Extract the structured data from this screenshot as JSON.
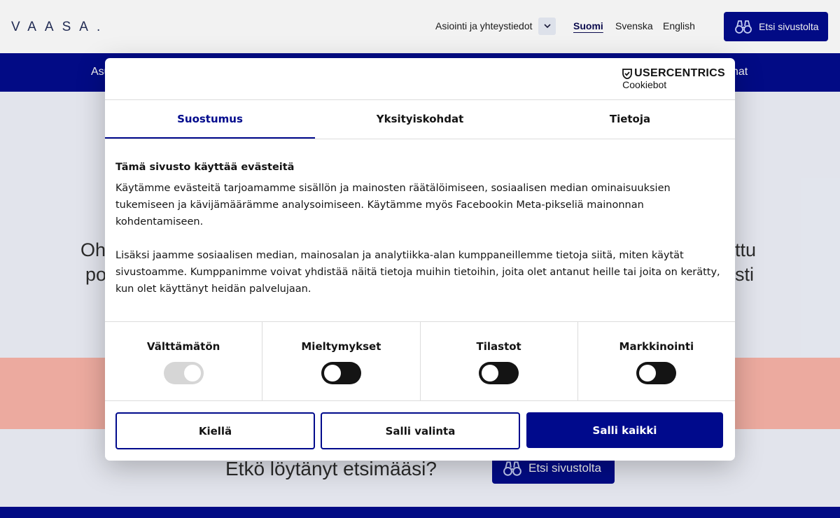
{
  "header": {
    "logo": "VAASA.",
    "service_link": "Asiointi ja yhteystiedot",
    "languages": [
      {
        "label": "Suomi",
        "active": true
      },
      {
        "label": "Svenska",
        "active": false
      },
      {
        "label": "English",
        "active": false
      }
    ],
    "search_button": "Etsi sivustolta"
  },
  "navbar": {
    "left_fragment": "Asu",
    "right_fragment": "nat"
  },
  "background": {
    "heading_left_1": "Oh",
    "heading_left_2": "po",
    "heading_right_1": "ttu",
    "heading_right_2": "sti",
    "not_found_question": "Etkö löytänyt etsimääsi?",
    "search_button": "Etsi sivustolta"
  },
  "dialog": {
    "brand_name": "USERCENTRICS",
    "brand_sub": "Cookiebot",
    "tabs": [
      {
        "label": "Suostumus",
        "active": true
      },
      {
        "label": "Yksityiskohdat",
        "active": false
      },
      {
        "label": "Tietoja",
        "active": false
      }
    ],
    "title": "Tämä sivusto käyttää evästeitä",
    "paragraph_1": "Käytämme evästeitä tarjoamamme sisällön ja mainosten räätälöimiseen, sosiaalisen median ominaisuuksien tukemiseen ja kävijämäärämme analysoimiseen. Käytämme myös Facebookin Meta-pikseliä mainonnan kohdentamiseen.",
    "paragraph_2": "Lisäksi jaamme sosiaalisen median, mainosalan ja analytiikka-alan kumppaneillemme tietoja siitä, miten käytät sivustoamme. Kumppanimme voivat yhdistää näitä tietoja muihin tietoihin, joita olet antanut heille tai joita on kerätty, kun olet käyttänyt heidän palvelujaan.",
    "categories": [
      {
        "label": "Välttämätön",
        "enabled": true,
        "locked": true
      },
      {
        "label": "Mieltymykset",
        "enabled": false,
        "locked": false
      },
      {
        "label": "Tilastot",
        "enabled": false,
        "locked": false
      },
      {
        "label": "Markkinointi",
        "enabled": false,
        "locked": false
      }
    ],
    "buttons": {
      "deny": "Kiellä",
      "allow_selection": "Salli valinta",
      "allow_all": "Salli kaikki"
    }
  },
  "colors": {
    "brand_blue": "#000a8c",
    "salmon": "#f9b3a7",
    "page_bg": "#eef1f9"
  }
}
